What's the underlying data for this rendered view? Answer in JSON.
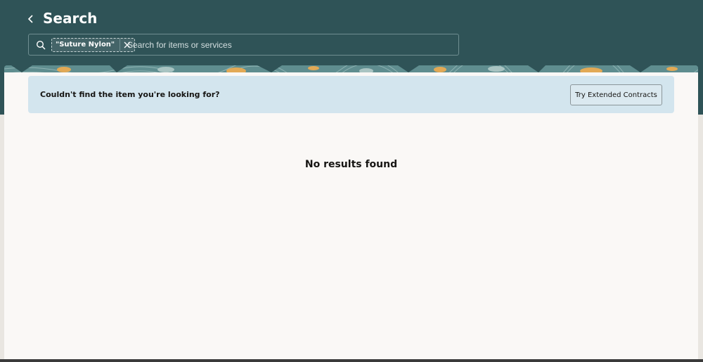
{
  "header": {
    "title": "Search",
    "back_icon": "chevron-left-icon"
  },
  "search": {
    "chip_label": "\"Suture Nylon\"",
    "placeholder": "Search for items or services",
    "value": ""
  },
  "banner": {
    "message": "Couldn't find the item you're looking for?",
    "button_label": "Try Extended Contracts"
  },
  "results": {
    "empty_message": "No results found"
  },
  "colors": {
    "header_bg": "#2f5357",
    "banner_bg": "#d3e5ee",
    "panel_bg": "#faf8f6",
    "pattern_orange": "#e2a955",
    "pattern_teal": "#6f9a9b"
  }
}
